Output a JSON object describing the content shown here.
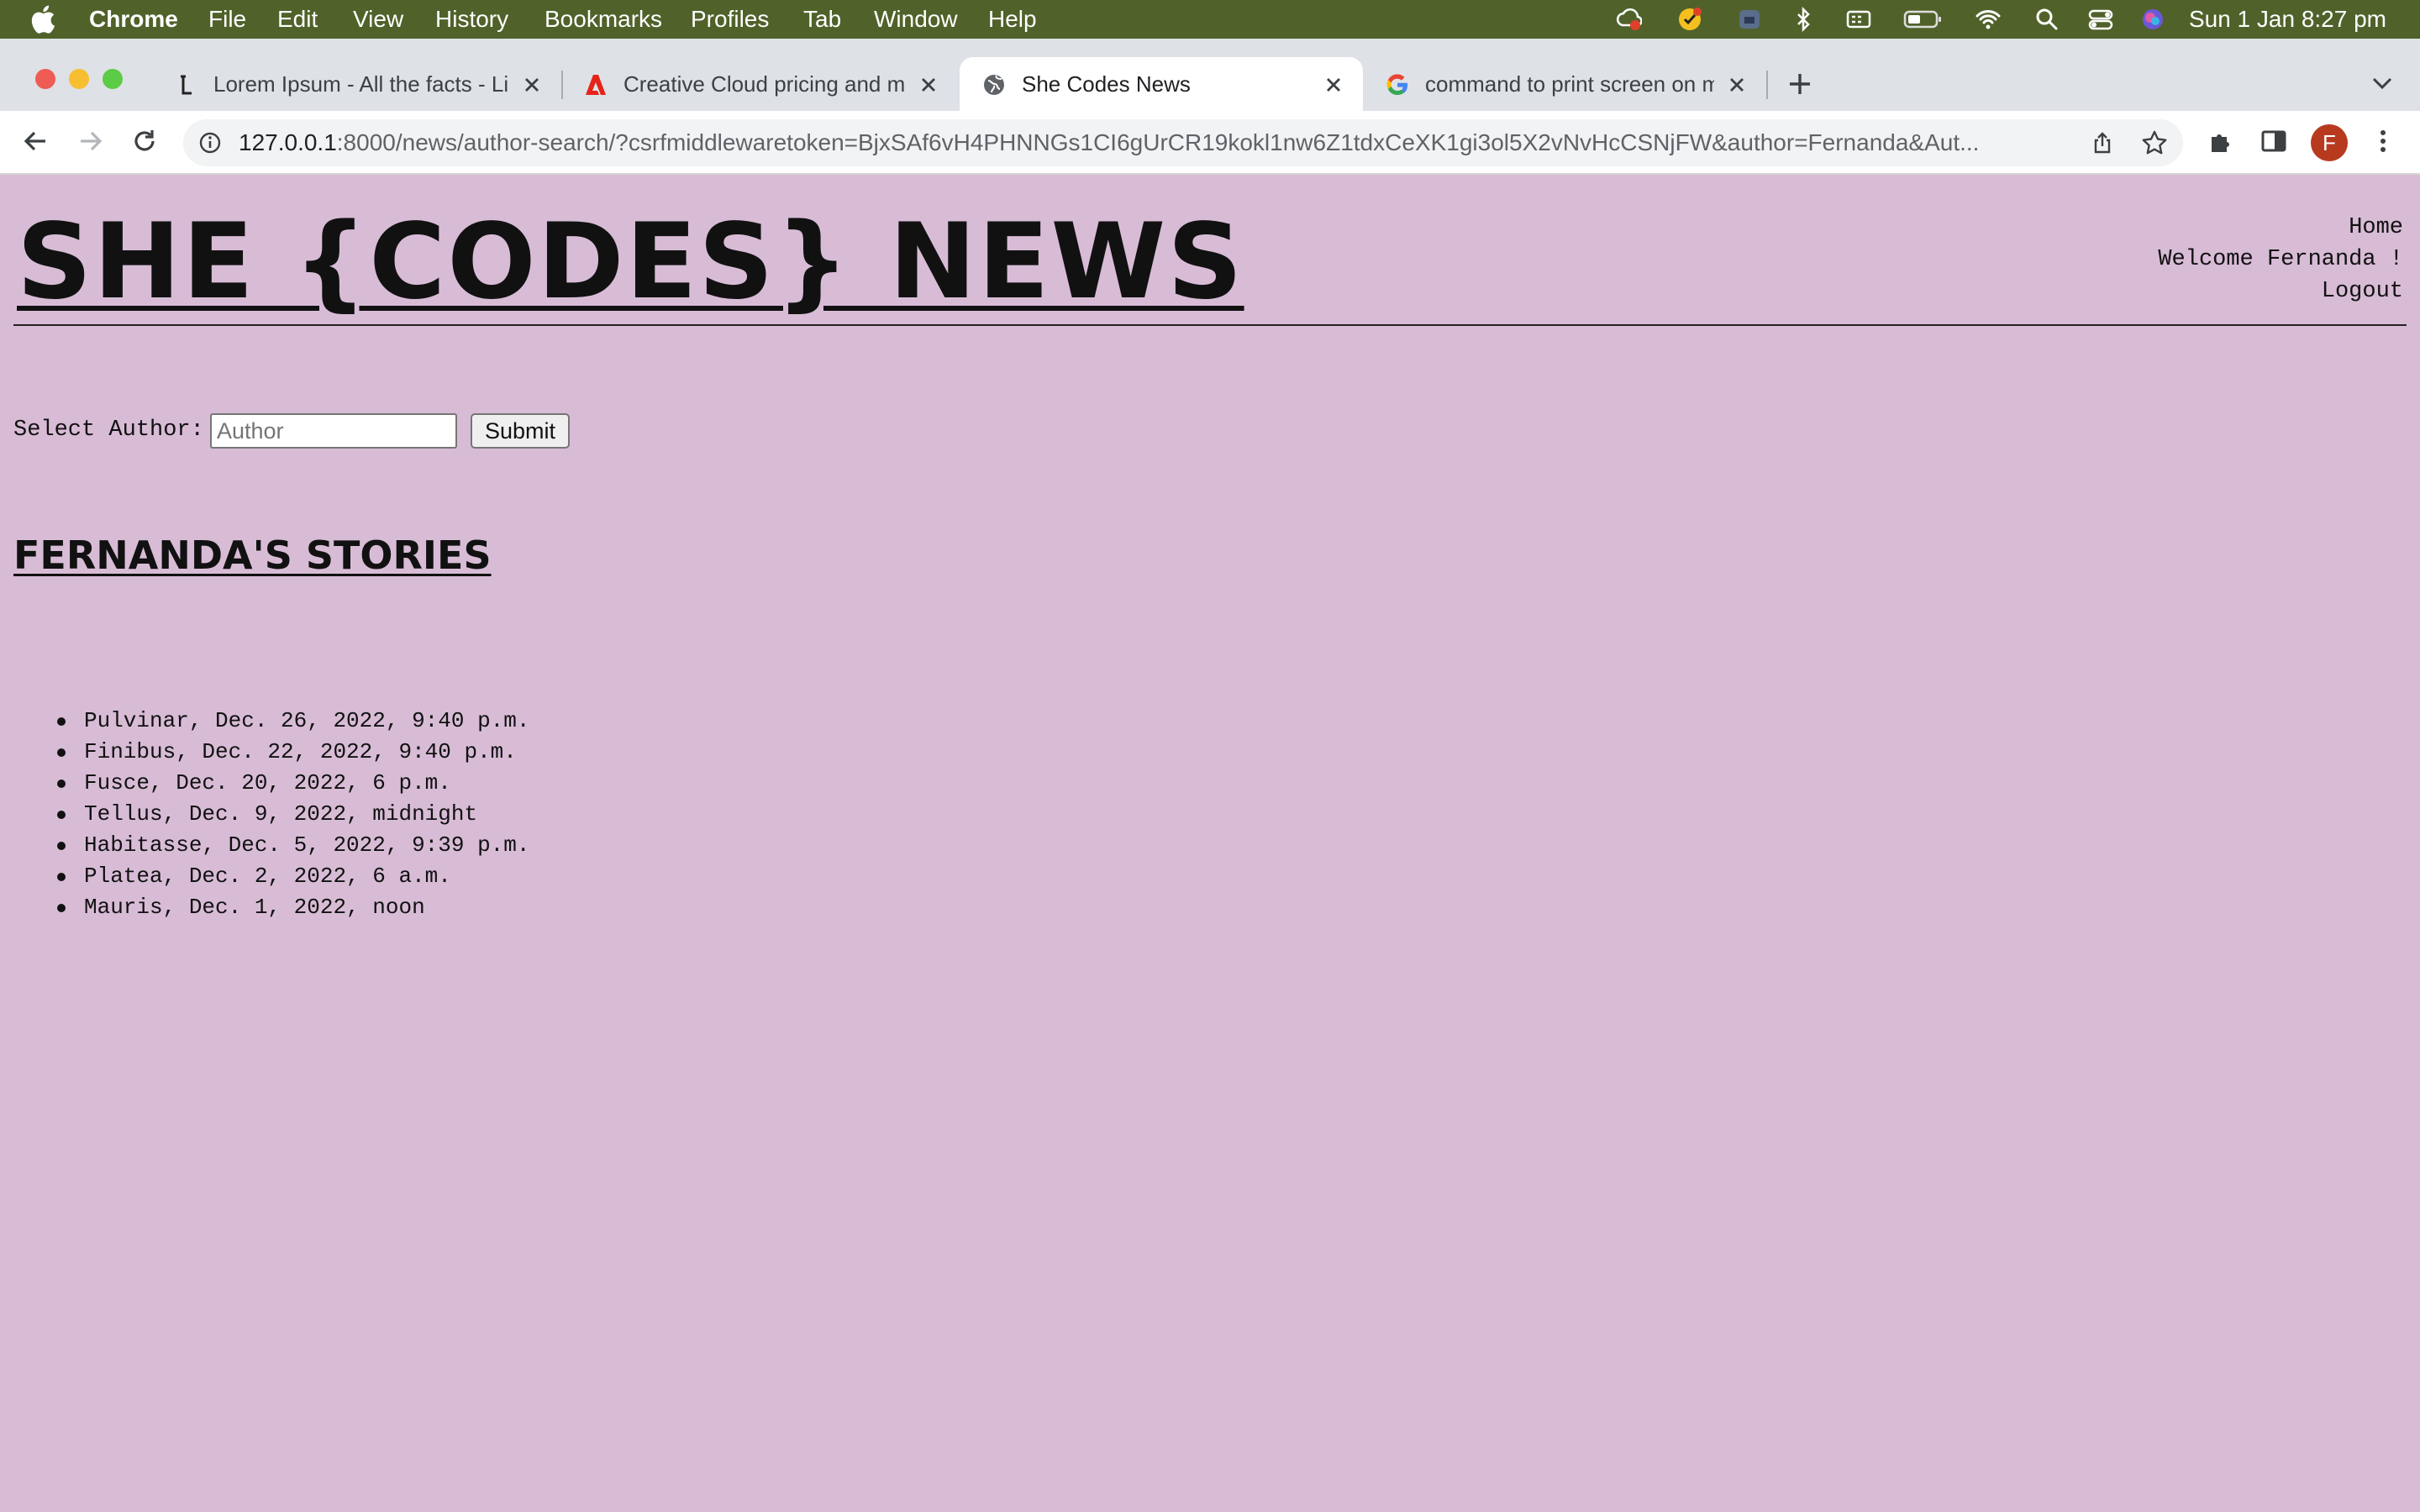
{
  "menubar": {
    "app_name": "Chrome",
    "items": [
      "File",
      "Edit",
      "View",
      "History",
      "Bookmarks",
      "Profiles",
      "Tab",
      "Window",
      "Help"
    ],
    "clock": "Sun 1 Jan  8:27 pm",
    "status_icons": [
      "creative-cloud-icon",
      "norton-icon",
      "vpn-icon",
      "bluetooth-icon",
      "keyboard-icon",
      "battery-icon",
      "wifi-icon",
      "spotlight-icon",
      "control-center-icon",
      "siri-icon"
    ]
  },
  "tabs": [
    {
      "title": "Lorem Ipsum - All the facts - Li",
      "favicon": "lipsum-icon",
      "active": false
    },
    {
      "title": "Creative Cloud pricing and mer",
      "favicon": "adobe-icon",
      "active": false
    },
    {
      "title": "She Codes News",
      "favicon": "globe-icon",
      "active": true
    },
    {
      "title": "command to print screen on m",
      "favicon": "google-icon",
      "active": false
    }
  ],
  "address_bar": {
    "host": "127.0.0.1",
    "rest": ":8000/news/author-search/?csrfmiddlewaretoken=BjxSAf6vH4PHNNGs1CI6gUrCR19kokl1nw6Z1tdxCeXK1gi3ol5X2vNvHcCSNjFW&author=Fernanda&Aut..."
  },
  "profile": {
    "initial": "F",
    "color": "#b73a1f"
  },
  "site": {
    "title": "SHE {CODES} NEWS",
    "nav": {
      "home": "Home",
      "welcome": "Welcome Fernanda !",
      "logout": "Logout"
    }
  },
  "search_form": {
    "label": "Select Author:",
    "placeholder": "Author",
    "submit_label": "Submit"
  },
  "stories": {
    "heading": "FERNANDA'S STORIES",
    "items": [
      "Pulvinar, Dec. 26, 2022, 9:40 p.m.",
      "Finibus, Dec. 22, 2022, 9:40 p.m.",
      "Fusce, Dec. 20, 2022, 6 p.m.",
      "Tellus, Dec. 9, 2022, midnight",
      "Habitasse, Dec. 5, 2022, 9:39 p.m.",
      "Platea, Dec. 2, 2022, 6 a.m.",
      "Mauris, Dec. 1, 2022, noon"
    ]
  },
  "colors": {
    "page_background": "#d8bcd6",
    "menubar_background": "#50622a",
    "tabstrip_background": "#dee1e6"
  }
}
